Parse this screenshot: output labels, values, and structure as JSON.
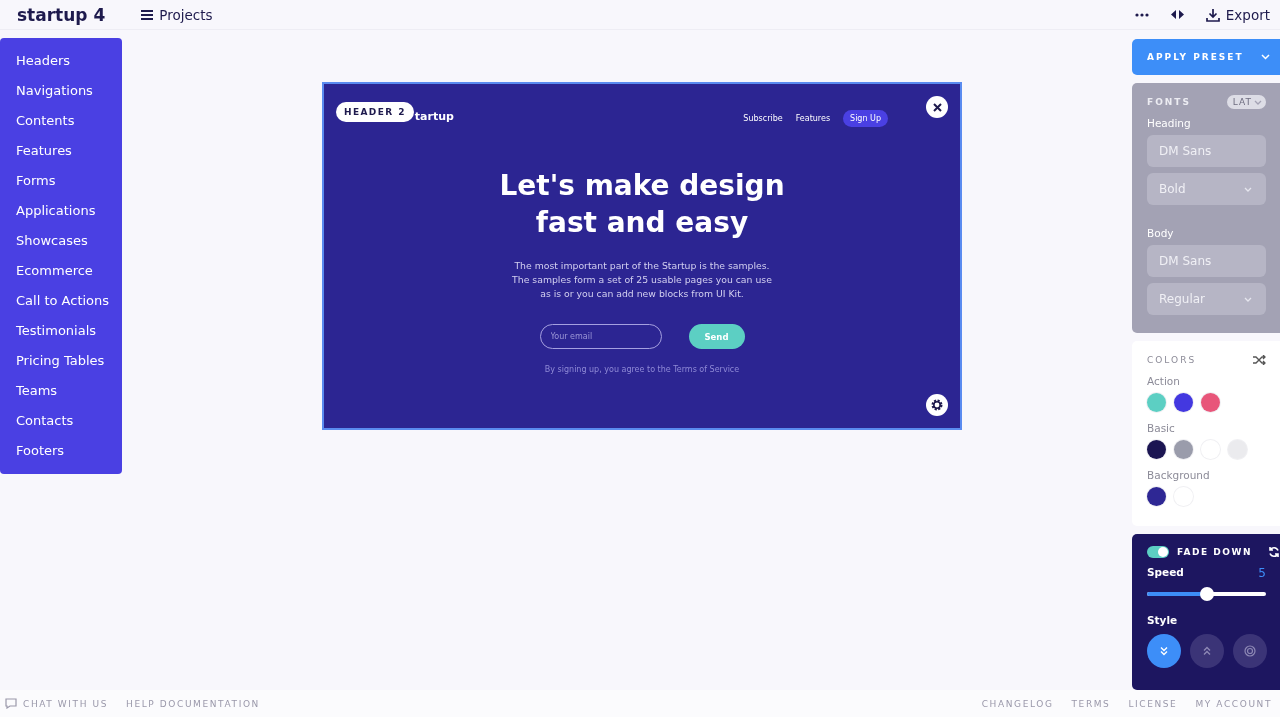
{
  "app": {
    "logo": "startup 4",
    "projects_label": "Projects",
    "export_label": "Export"
  },
  "sidebar": {
    "items": [
      {
        "label": "Headers"
      },
      {
        "label": "Navigations"
      },
      {
        "label": "Contents"
      },
      {
        "label": "Features"
      },
      {
        "label": "Forms"
      },
      {
        "label": "Applications"
      },
      {
        "label": "Showcases"
      },
      {
        "label": "Ecommerce"
      },
      {
        "label": "Call to Actions"
      },
      {
        "label": "Testimonials"
      },
      {
        "label": "Pricing Tables"
      },
      {
        "label": "Teams"
      },
      {
        "label": "Contacts"
      },
      {
        "label": "Footers"
      }
    ]
  },
  "preview": {
    "badge": "HEADER 2",
    "brand": "tartup",
    "nav": [
      {
        "label": "Subscribe",
        "kind": "link"
      },
      {
        "label": "Features",
        "kind": "link"
      },
      {
        "label": "Sign Up",
        "kind": "button"
      }
    ],
    "heading": "Let's make design fast and easy",
    "text": "The most important part of the Startup is the samples. The samples form a set of 25 usable pages you can use as is or you can add new blocks from UI Kit.",
    "email_placeholder": "Your email",
    "send_label": "Send",
    "terms": "By signing up, you agree to the Terms of Service"
  },
  "panel": {
    "apply_preset": "APPLY PRESET",
    "fonts": {
      "title": "FONTS",
      "script": "LAT",
      "groups": [
        {
          "label": "Heading",
          "family": "DM Sans",
          "weight": "Bold"
        },
        {
          "label": "Body",
          "family": "DM Sans",
          "weight": "Regular"
        }
      ]
    },
    "colors": {
      "title": "COLORS",
      "groups": [
        {
          "label": "Action",
          "swatches": [
            {
              "color": "#5ccfc3"
            },
            {
              "color": "#4338e0"
            },
            {
              "color": "#e8567a"
            }
          ]
        },
        {
          "label": "Basic",
          "swatches": [
            {
              "color": "#1b1552"
            },
            {
              "color": "#9a9cab"
            },
            {
              "color": "#ffffff"
            },
            {
              "color": "#ebebee"
            }
          ]
        },
        {
          "label": "Background",
          "swatches": [
            {
              "color": "#2e2794"
            },
            {
              "color": "#ffffff"
            }
          ]
        }
      ]
    },
    "animation": {
      "on": true,
      "title": "FADE DOWN",
      "speed_label": "Speed",
      "speed_value": "5",
      "level": 0.5,
      "style_label": "Style",
      "styles": [
        {
          "kind": "down",
          "selected": true
        },
        {
          "kind": "up",
          "selected": false
        },
        {
          "kind": "zoom",
          "selected": false
        }
      ]
    }
  },
  "footer": {
    "left": [
      "CHAT WITH US",
      "HELP DOCUMENTATION"
    ],
    "right": [
      "CHANGELOG",
      "TERMS",
      "LICENSE",
      "MY ACCOUNT"
    ]
  }
}
